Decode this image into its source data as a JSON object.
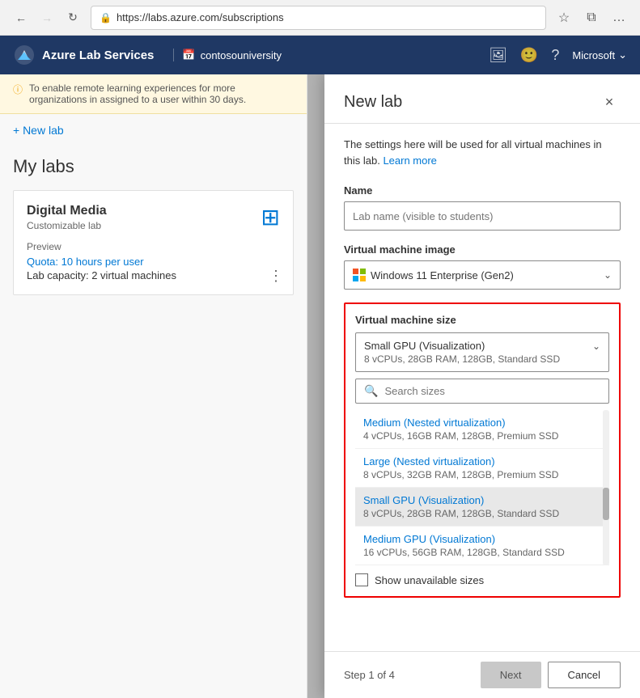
{
  "browser": {
    "url": "https://labs.azure.com/subscriptions",
    "back_disabled": false,
    "forward_disabled": true
  },
  "header": {
    "app_name": "Azure Lab Services",
    "org_name": "contosouniversity",
    "account_name": "Microsoft"
  },
  "left_panel": {
    "banner_text": "To enable remote learning experiences for more organizations in assigned to a user within 30 days.",
    "new_lab_label": "+ New lab",
    "my_labs_title": "My labs",
    "lab": {
      "name": "Digital Media",
      "type": "Customizable lab",
      "status": "Preview",
      "quota_label": "Quota:",
      "quota_value": "10 hours per user",
      "capacity": "Lab capacity: 2 virtual machines"
    }
  },
  "dialog": {
    "title": "New lab",
    "description": "The settings here will be used for all virtual machines in this lab.",
    "learn_more": "Learn more",
    "close_label": "×",
    "form": {
      "name_label": "Name",
      "name_placeholder": "Lab name (visible to students)",
      "vm_image_label": "Virtual machine image",
      "vm_image_value": "Windows 11 Enterprise (Gen2)",
      "vm_size_label": "Virtual machine size",
      "vm_size_selected": "Small GPU (Visualization)",
      "vm_size_specs": "8 vCPUs, 28GB RAM, 128GB, Standard SSD",
      "search_placeholder": "Search sizes"
    },
    "sizes": [
      {
        "name": "Medium (Nested virtualization)",
        "specs": "4 vCPUs, 16GB RAM, 128GB, Premium SSD",
        "selected": false
      },
      {
        "name": "Large (Nested virtualization)",
        "specs": "8 vCPUs, 32GB RAM, 128GB, Premium SSD",
        "selected": false
      },
      {
        "name": "Small GPU (Visualization)",
        "specs": "8 vCPUs, 28GB RAM, 128GB, Standard SSD",
        "selected": true
      },
      {
        "name": "Medium GPU (Visualization)",
        "specs": "16 vCPUs, 56GB RAM, 128GB, Standard SSD",
        "selected": false
      }
    ],
    "show_unavailable_label": "Show unavailable sizes",
    "footer": {
      "step_text": "Step 1 of 4",
      "next_label": "Next",
      "cancel_label": "Cancel"
    }
  }
}
